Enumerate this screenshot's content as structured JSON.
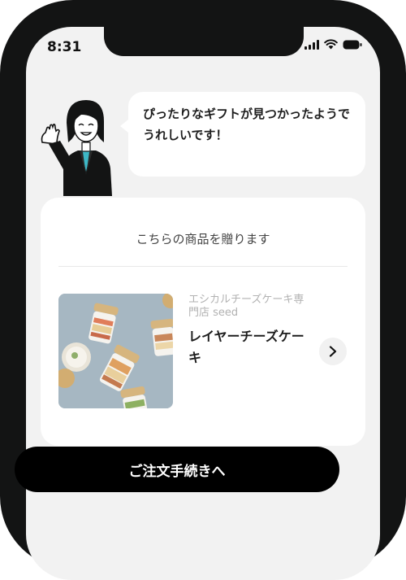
{
  "status_bar": {
    "time": "8:31",
    "icons": [
      "signal-icon",
      "wifi-icon",
      "battery-icon"
    ]
  },
  "assistant": {
    "message": "ぴったりなギフトが見つかったようでうれしいです！"
  },
  "gift_card": {
    "heading": "こちらの商品を贈ります",
    "product": {
      "shop_name": "エシカルチーズケーキ専門店 seed",
      "name": "レイヤーチーズケーキ",
      "detail_icon": "chevron-right-icon"
    }
  },
  "order_button": {
    "label": "ご注文手続きへ"
  },
  "colors": {
    "frame": "#131414",
    "screen_bg": "#f2f2f2",
    "card_bg": "#ffffff",
    "button_bg": "#000000",
    "button_text": "#ffffff"
  }
}
